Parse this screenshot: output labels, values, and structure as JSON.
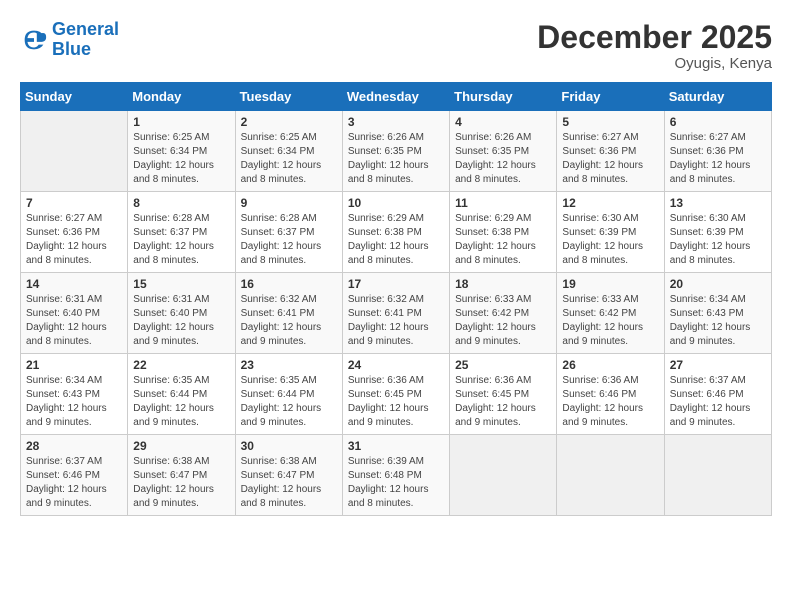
{
  "header": {
    "logo_general": "General",
    "logo_blue": "Blue",
    "month_title": "December 2025",
    "location": "Oyugis, Kenya"
  },
  "calendar": {
    "days_of_week": [
      "Sunday",
      "Monday",
      "Tuesday",
      "Wednesday",
      "Thursday",
      "Friday",
      "Saturday"
    ],
    "weeks": [
      [
        {
          "day": "",
          "sunrise": "",
          "sunset": "",
          "daylight": ""
        },
        {
          "day": "1",
          "sunrise": "Sunrise: 6:25 AM",
          "sunset": "Sunset: 6:34 PM",
          "daylight": "Daylight: 12 hours and 8 minutes."
        },
        {
          "day": "2",
          "sunrise": "Sunrise: 6:25 AM",
          "sunset": "Sunset: 6:34 PM",
          "daylight": "Daylight: 12 hours and 8 minutes."
        },
        {
          "day": "3",
          "sunrise": "Sunrise: 6:26 AM",
          "sunset": "Sunset: 6:35 PM",
          "daylight": "Daylight: 12 hours and 8 minutes."
        },
        {
          "day": "4",
          "sunrise": "Sunrise: 6:26 AM",
          "sunset": "Sunset: 6:35 PM",
          "daylight": "Daylight: 12 hours and 8 minutes."
        },
        {
          "day": "5",
          "sunrise": "Sunrise: 6:27 AM",
          "sunset": "Sunset: 6:36 PM",
          "daylight": "Daylight: 12 hours and 8 minutes."
        },
        {
          "day": "6",
          "sunrise": "Sunrise: 6:27 AM",
          "sunset": "Sunset: 6:36 PM",
          "daylight": "Daylight: 12 hours and 8 minutes."
        }
      ],
      [
        {
          "day": "7",
          "sunrise": "Sunrise: 6:27 AM",
          "sunset": "Sunset: 6:36 PM",
          "daylight": "Daylight: 12 hours and 8 minutes."
        },
        {
          "day": "8",
          "sunrise": "Sunrise: 6:28 AM",
          "sunset": "Sunset: 6:37 PM",
          "daylight": "Daylight: 12 hours and 8 minutes."
        },
        {
          "day": "9",
          "sunrise": "Sunrise: 6:28 AM",
          "sunset": "Sunset: 6:37 PM",
          "daylight": "Daylight: 12 hours and 8 minutes."
        },
        {
          "day": "10",
          "sunrise": "Sunrise: 6:29 AM",
          "sunset": "Sunset: 6:38 PM",
          "daylight": "Daylight: 12 hours and 8 minutes."
        },
        {
          "day": "11",
          "sunrise": "Sunrise: 6:29 AM",
          "sunset": "Sunset: 6:38 PM",
          "daylight": "Daylight: 12 hours and 8 minutes."
        },
        {
          "day": "12",
          "sunrise": "Sunrise: 6:30 AM",
          "sunset": "Sunset: 6:39 PM",
          "daylight": "Daylight: 12 hours and 8 minutes."
        },
        {
          "day": "13",
          "sunrise": "Sunrise: 6:30 AM",
          "sunset": "Sunset: 6:39 PM",
          "daylight": "Daylight: 12 hours and 8 minutes."
        }
      ],
      [
        {
          "day": "14",
          "sunrise": "Sunrise: 6:31 AM",
          "sunset": "Sunset: 6:40 PM",
          "daylight": "Daylight: 12 hours and 8 minutes."
        },
        {
          "day": "15",
          "sunrise": "Sunrise: 6:31 AM",
          "sunset": "Sunset: 6:40 PM",
          "daylight": "Daylight: 12 hours and 9 minutes."
        },
        {
          "day": "16",
          "sunrise": "Sunrise: 6:32 AM",
          "sunset": "Sunset: 6:41 PM",
          "daylight": "Daylight: 12 hours and 9 minutes."
        },
        {
          "day": "17",
          "sunrise": "Sunrise: 6:32 AM",
          "sunset": "Sunset: 6:41 PM",
          "daylight": "Daylight: 12 hours and 9 minutes."
        },
        {
          "day": "18",
          "sunrise": "Sunrise: 6:33 AM",
          "sunset": "Sunset: 6:42 PM",
          "daylight": "Daylight: 12 hours and 9 minutes."
        },
        {
          "day": "19",
          "sunrise": "Sunrise: 6:33 AM",
          "sunset": "Sunset: 6:42 PM",
          "daylight": "Daylight: 12 hours and 9 minutes."
        },
        {
          "day": "20",
          "sunrise": "Sunrise: 6:34 AM",
          "sunset": "Sunset: 6:43 PM",
          "daylight": "Daylight: 12 hours and 9 minutes."
        }
      ],
      [
        {
          "day": "21",
          "sunrise": "Sunrise: 6:34 AM",
          "sunset": "Sunset: 6:43 PM",
          "daylight": "Daylight: 12 hours and 9 minutes."
        },
        {
          "day": "22",
          "sunrise": "Sunrise: 6:35 AM",
          "sunset": "Sunset: 6:44 PM",
          "daylight": "Daylight: 12 hours and 9 minutes."
        },
        {
          "day": "23",
          "sunrise": "Sunrise: 6:35 AM",
          "sunset": "Sunset: 6:44 PM",
          "daylight": "Daylight: 12 hours and 9 minutes."
        },
        {
          "day": "24",
          "sunrise": "Sunrise: 6:36 AM",
          "sunset": "Sunset: 6:45 PM",
          "daylight": "Daylight: 12 hours and 9 minutes."
        },
        {
          "day": "25",
          "sunrise": "Sunrise: 6:36 AM",
          "sunset": "Sunset: 6:45 PM",
          "daylight": "Daylight: 12 hours and 9 minutes."
        },
        {
          "day": "26",
          "sunrise": "Sunrise: 6:36 AM",
          "sunset": "Sunset: 6:46 PM",
          "daylight": "Daylight: 12 hours and 9 minutes."
        },
        {
          "day": "27",
          "sunrise": "Sunrise: 6:37 AM",
          "sunset": "Sunset: 6:46 PM",
          "daylight": "Daylight: 12 hours and 9 minutes."
        }
      ],
      [
        {
          "day": "28",
          "sunrise": "Sunrise: 6:37 AM",
          "sunset": "Sunset: 6:46 PM",
          "daylight": "Daylight: 12 hours and 9 minutes."
        },
        {
          "day": "29",
          "sunrise": "Sunrise: 6:38 AM",
          "sunset": "Sunset: 6:47 PM",
          "daylight": "Daylight: 12 hours and 9 minutes."
        },
        {
          "day": "30",
          "sunrise": "Sunrise: 6:38 AM",
          "sunset": "Sunset: 6:47 PM",
          "daylight": "Daylight: 12 hours and 8 minutes."
        },
        {
          "day": "31",
          "sunrise": "Sunrise: 6:39 AM",
          "sunset": "Sunset: 6:48 PM",
          "daylight": "Daylight: 12 hours and 8 minutes."
        },
        {
          "day": "",
          "sunrise": "",
          "sunset": "",
          "daylight": ""
        },
        {
          "day": "",
          "sunrise": "",
          "sunset": "",
          "daylight": ""
        },
        {
          "day": "",
          "sunrise": "",
          "sunset": "",
          "daylight": ""
        }
      ]
    ]
  }
}
